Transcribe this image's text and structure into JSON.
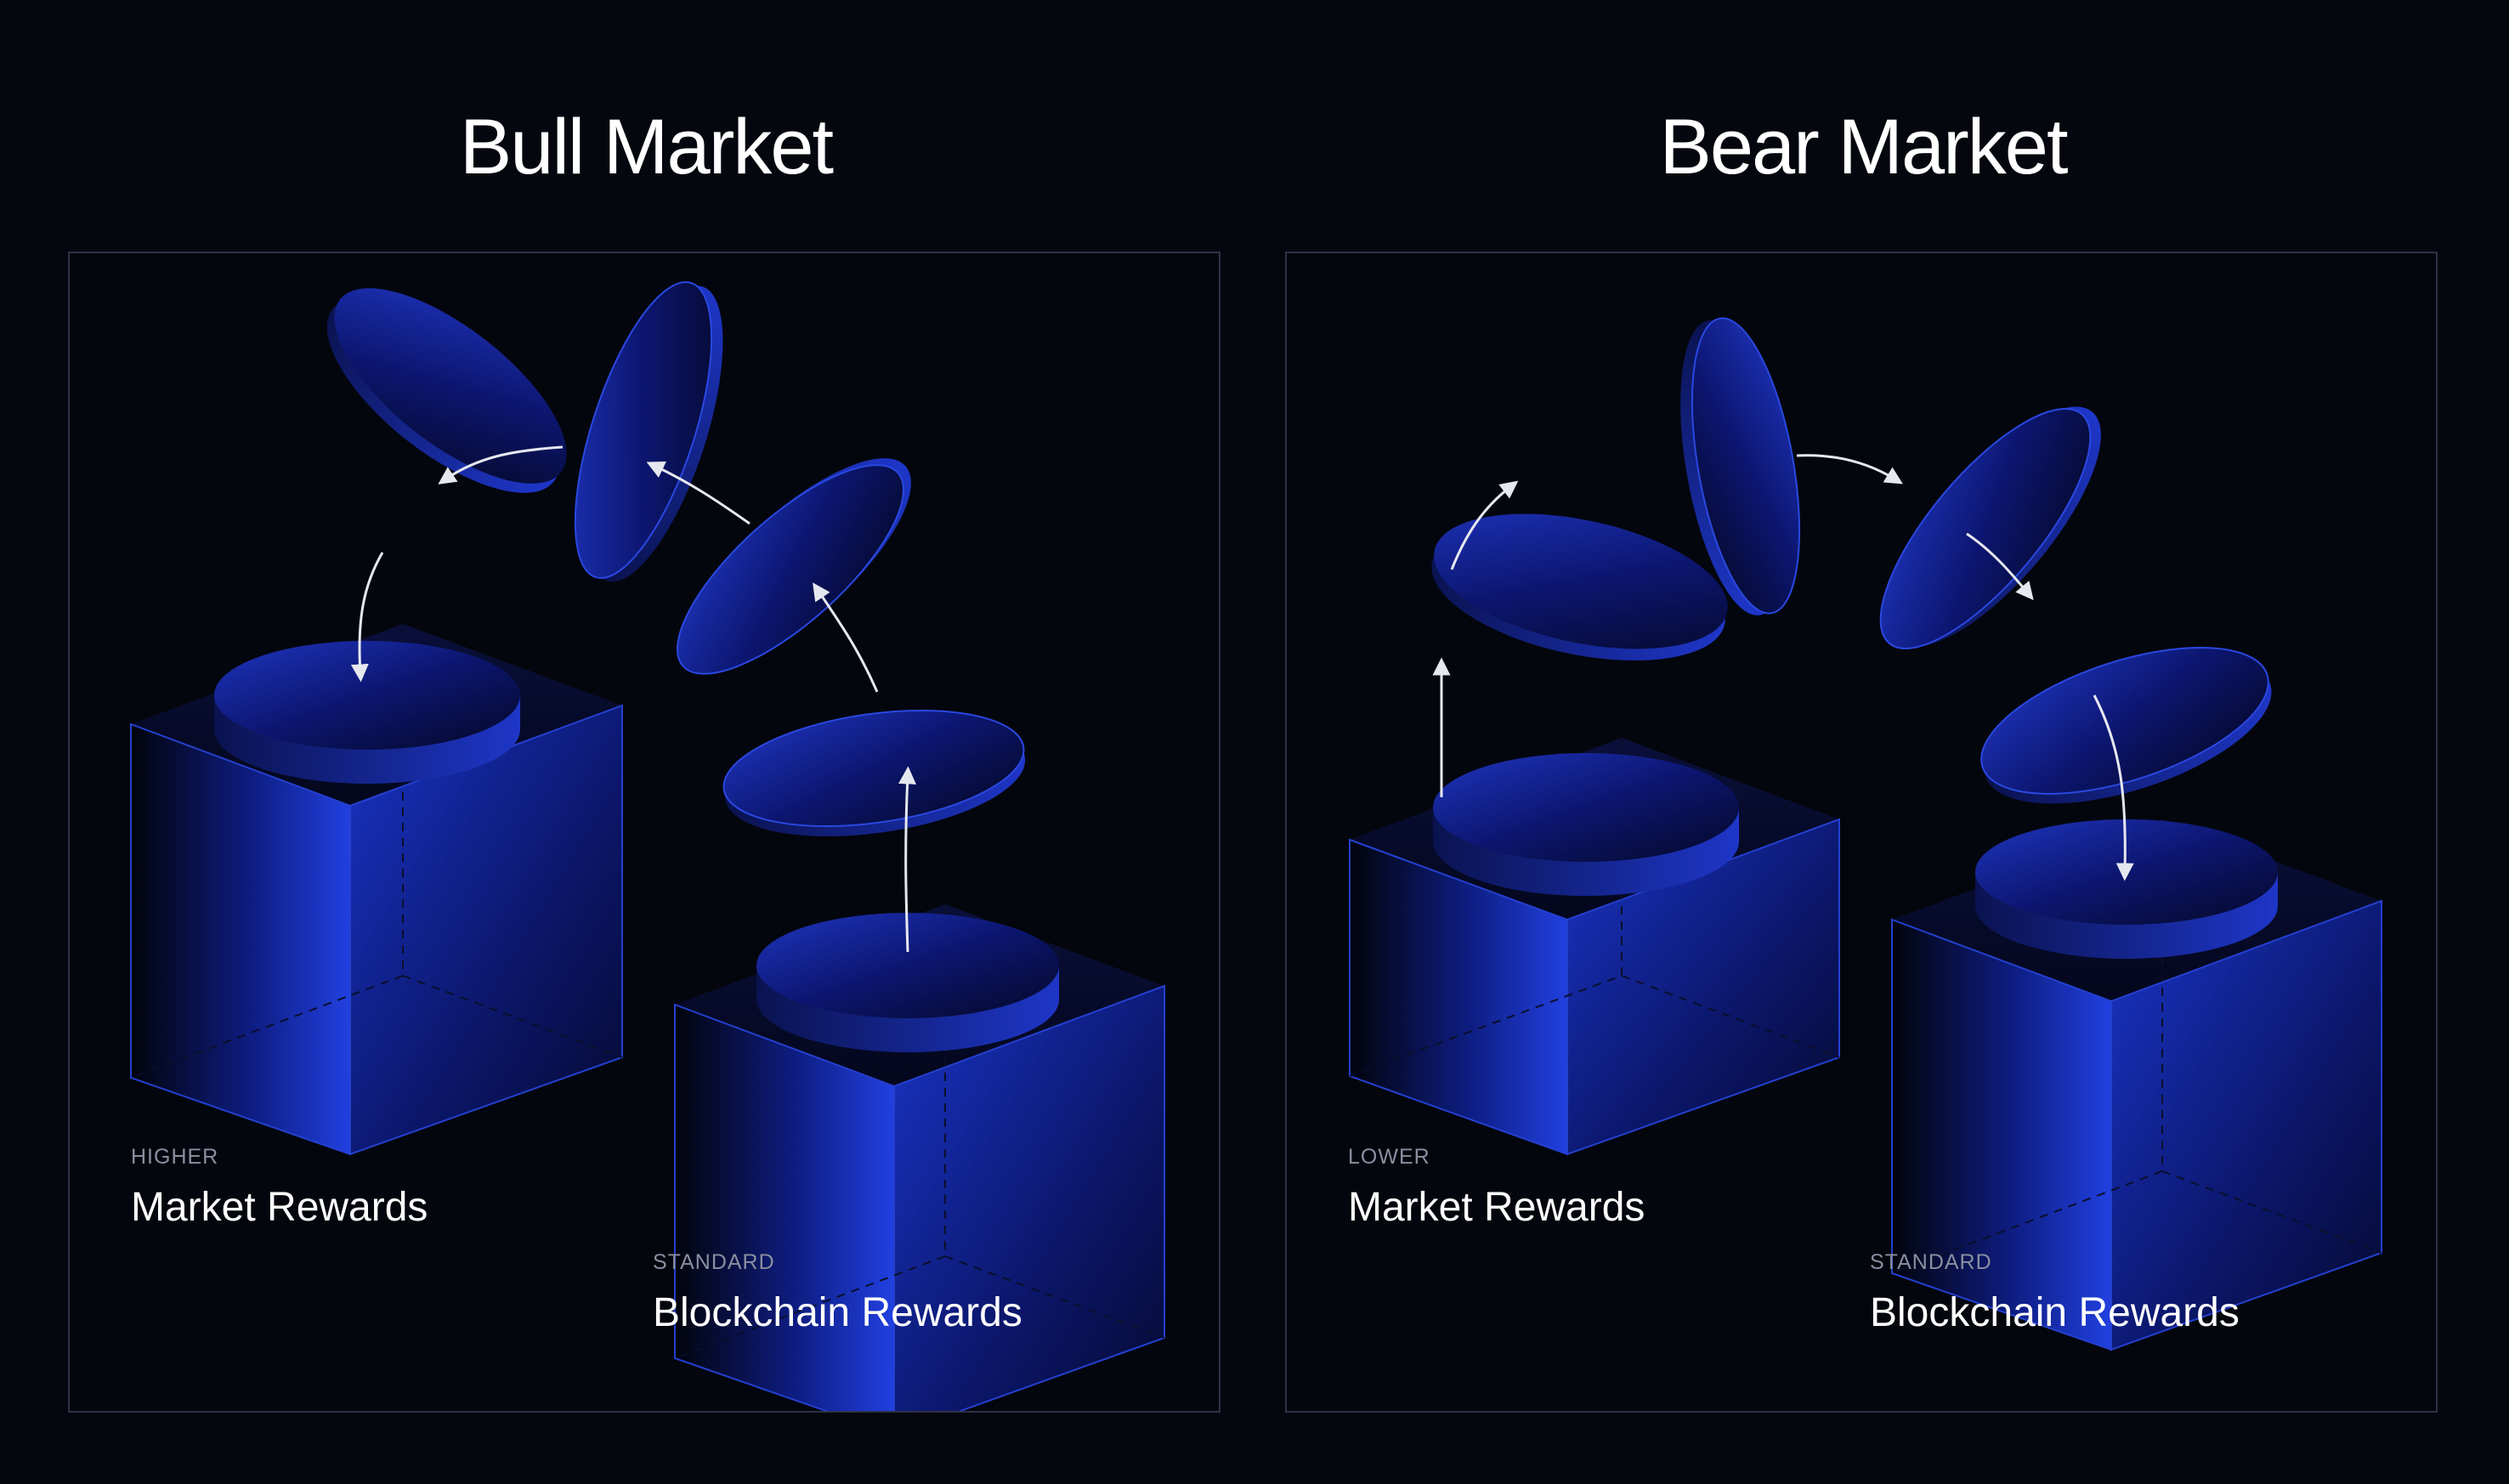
{
  "bull": {
    "title": "Bull Market",
    "market_tier": "HIGHER",
    "market_label": "Market Rewards",
    "chain_tier": "STANDARD",
    "chain_label": "Blockchain Rewards"
  },
  "bear": {
    "title": "Bear Market",
    "market_tier": "LOWER",
    "market_label": "Market Rewards",
    "chain_tier": "STANDARD",
    "chain_label": "Blockchain Rewards"
  },
  "colors": {
    "background": "#05070f",
    "panel_border": "#2e3247",
    "cube_blue": "#1c3ad8",
    "coin_blue": "#1a2a9e",
    "arrow": "#e6e8f0",
    "caption_tier": "#8a8ea0"
  }
}
